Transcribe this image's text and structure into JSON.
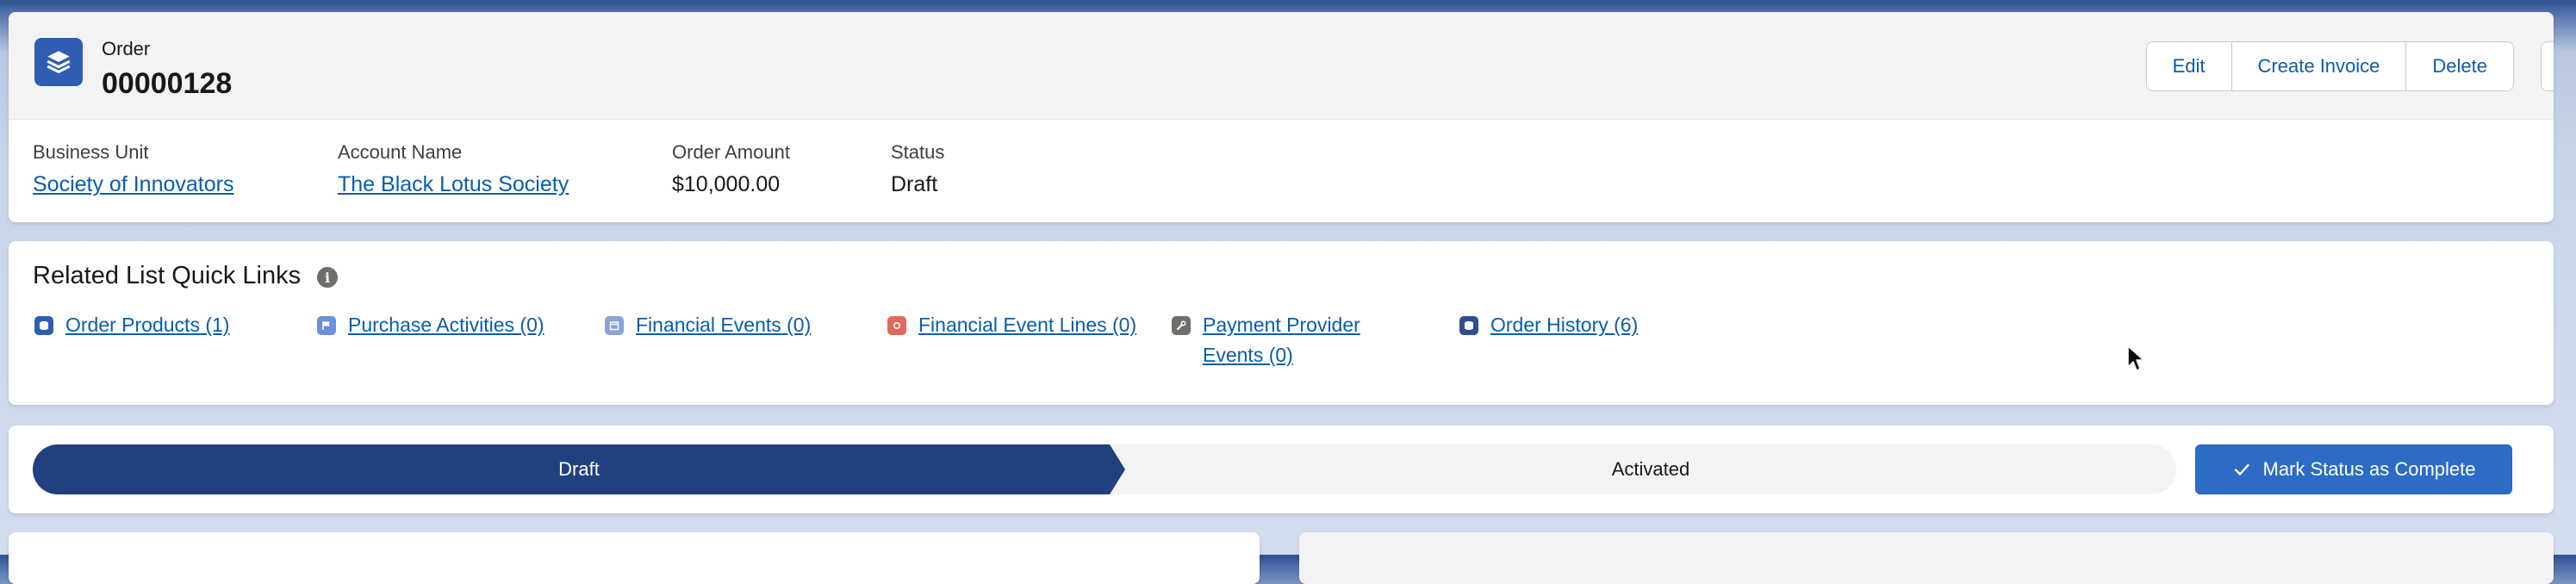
{
  "header": {
    "object_label": "Order",
    "record_title": "00000128",
    "icon": "order-stack-icon",
    "actions": [
      "Edit",
      "Create Invoice",
      "Delete"
    ]
  },
  "fields": [
    {
      "label": "Business Unit",
      "value": "Society of Innovators",
      "link": true
    },
    {
      "label": "Account Name",
      "value": "The Black Lotus Society",
      "link": true
    },
    {
      "label": "Order Amount",
      "value": "$10,000.00",
      "link": false
    },
    {
      "label": "Status",
      "value": "Draft",
      "link": false
    }
  ],
  "quick_links": {
    "title": "Related List Quick Links",
    "info_icon": "info-icon",
    "items": [
      {
        "label": "Order Products (1)",
        "icon": "order-products-icon",
        "color": "#2f5db3"
      },
      {
        "label": "Purchase Activities (0)",
        "icon": "flag-icon",
        "color": "#6b8fd8"
      },
      {
        "label": "Financial Events (0)",
        "icon": "calendar-icon",
        "color": "#8aa4d6"
      },
      {
        "label": "Financial Event Lines (0)",
        "icon": "event-lines-icon",
        "color": "#e06a5a"
      },
      {
        "label": "Payment Provider Events (0)",
        "label_line1": "Payment Provider",
        "label_line2": "Events (0)",
        "icon": "wrench-icon",
        "color": "#706e6b"
      },
      {
        "label": "Order History (6)",
        "icon": "order-history-icon",
        "color": "#2f4f8e"
      }
    ]
  },
  "path": {
    "stages": [
      "Draft",
      "Activated"
    ],
    "current": "Draft",
    "mark_button": "Mark Status as Complete",
    "active_color": "#21407f"
  },
  "colors": {
    "brand": "#2f5db3",
    "link": "#0b5cab",
    "button": "#2d6cc4"
  }
}
